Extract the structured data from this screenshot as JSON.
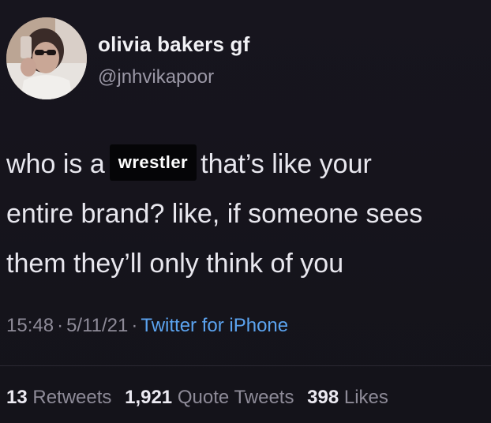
{
  "user": {
    "display_name": "olivia bakers gf",
    "handle": "@jnhvikapoor",
    "avatar_icon": "profile-photo"
  },
  "tweet": {
    "line1_before": "who is a",
    "redaction_label": "wrestler",
    "line1_after": "that’s like your",
    "line2": "entire brand? like, if someone sees",
    "line3": "them they’ll only think of you"
  },
  "meta": {
    "time": "15:48",
    "separator": "·",
    "date": "5/11/21",
    "source": "Twitter for iPhone"
  },
  "stats": {
    "retweets_count": "13",
    "retweets_label": "Retweets",
    "quote_count": "1,921",
    "quote_label": "Quote Tweets",
    "likes_count": "398",
    "likes_label": "Likes"
  },
  "colors": {
    "background": "#16141d",
    "text": "#e8e7ee",
    "muted": "#8e8b98",
    "link": "#5ba3ef",
    "redaction_bg": "#050507"
  }
}
